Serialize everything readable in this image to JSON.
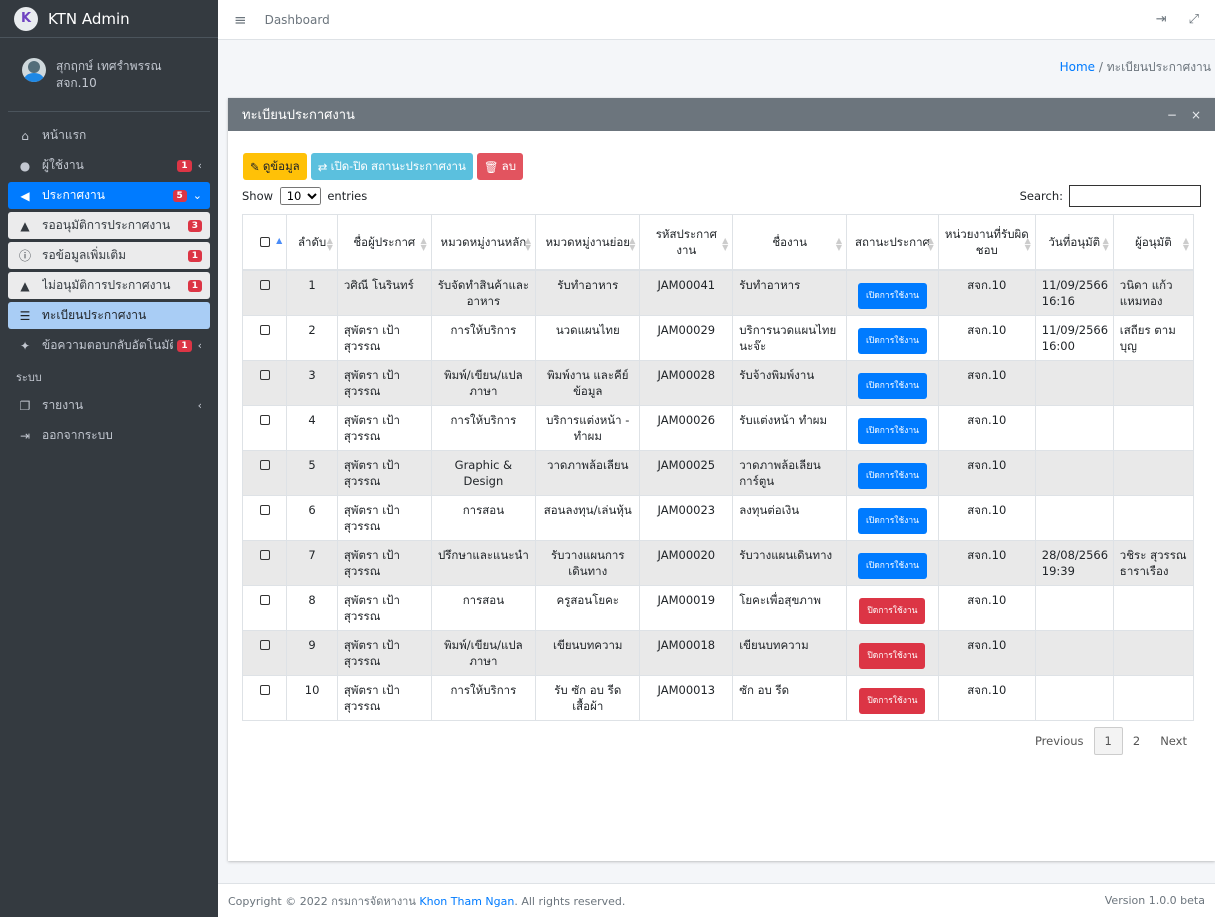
{
  "brand": {
    "name": "KTN Admin"
  },
  "user": {
    "name_line1": "สุกฤกษ์ เทศรำพรรณ",
    "name_line2": "สจก.10"
  },
  "nav": {
    "home": "หน้าแรก",
    "users": {
      "label": "ผู้ใช้งาน",
      "badge": "1"
    },
    "jobs": {
      "label": "ประกาศงาน",
      "badge": "5"
    },
    "pending": {
      "label": "รออนุมัติการประกาศงาน",
      "badge": "3"
    },
    "more_info": {
      "label": "รอข้อมูลเพิ่มเติม",
      "badge": "1"
    },
    "rejected": {
      "label": "ไม่อนุมัติการประกาศงาน",
      "badge": "1"
    },
    "registry": {
      "label": "ทะเบียนประกาศงาน"
    },
    "auto_reply": {
      "label": "ข้อความตอบกลับอัตโนมัติ",
      "badge": "1"
    },
    "system_header": "ระบบ",
    "reports": "รายงาน",
    "logout": "ออกจากระบบ"
  },
  "topbar": {
    "title": "Dashboard"
  },
  "breadcrumb": {
    "home": "Home",
    "sep": "/",
    "current": "ทะเบียนประกาศงาน"
  },
  "card": {
    "title": "ทะเบียนประกาศงาน",
    "buttons": {
      "view": "ดูข้อมูล",
      "toggle": "เปิด-ปิด สถานะประกาศงาน",
      "delete": "ลบ"
    },
    "show": "Show",
    "length_value": "10",
    "entries": "entries",
    "search_label": "Search:",
    "columns": [
      "ลำดับ",
      "ชื่อผู้ประกาศ",
      "หมวดหมู่งานหลัก",
      "หมวดหมู่งานย่อย",
      "รหัสประกาศงาน",
      "ชื่องาน",
      "สถานะประกาศ",
      "หน่วยงานที่รับผิดชอบ",
      "วันที่อนุมัติ",
      "ผู้อนุมัติ"
    ],
    "rows": [
      {
        "no": "1",
        "poster": "วศิณี โนรินทร์",
        "main": "รับจัดทำสินค้าและอาหาร",
        "sub": "รับทำอาหาร",
        "code": "JAM00041",
        "job": "รับทำอาหาร",
        "status": "เปิดการใช้งาน",
        "status_color": "#007bff",
        "unit": "สจก.10",
        "date": "11/09/2566 16:16",
        "approver": "วนิดา แก้วแหมทอง"
      },
      {
        "no": "2",
        "poster": "สุพัตรา เป้าสุวรรณ",
        "main": "การให้บริการ",
        "sub": "นวดแผนไทย",
        "code": "JAM00029",
        "job": "บริการนวดแผนไทย นะจ๊ะ",
        "status": "เปิดการใช้งาน",
        "status_color": "#007bff",
        "unit": "สจก.10",
        "date": "11/09/2566 16:00",
        "approver": "เสถียร ตามบุญ"
      },
      {
        "no": "3",
        "poster": "สุพัตรา เป้าสุวรรณ",
        "main": "พิมพ์/เขียน/แปลภาษา",
        "sub": "พิมพ์งาน และคีย์ข้อมูล",
        "code": "JAM00028",
        "job": "รับจ้างพิมพ์งาน",
        "status": "เปิดการใช้งาน",
        "status_color": "#007bff",
        "unit": "สจก.10",
        "date": "",
        "approver": ""
      },
      {
        "no": "4",
        "poster": "สุพัตรา เป้าสุวรรณ",
        "main": "การให้บริการ",
        "sub": "บริการแต่งหน้า - ทำผม",
        "code": "JAM00026",
        "job": "รับแต่งหน้า ทำผม",
        "status": "เปิดการใช้งาน",
        "status_color": "#007bff",
        "unit": "สจก.10",
        "date": "",
        "approver": ""
      },
      {
        "no": "5",
        "poster": "สุพัตรา เป้าสุวรรณ",
        "main": "Graphic & Design",
        "sub": "วาดภาพล้อเลียน",
        "code": "JAM00025",
        "job": "วาดภาพล้อเลียนการ์ตูน",
        "status": "เปิดการใช้งาน",
        "status_color": "#007bff",
        "unit": "สจก.10",
        "date": "",
        "approver": ""
      },
      {
        "no": "6",
        "poster": "สุพัตรา เป้าสุวรรณ",
        "main": "การสอน",
        "sub": "สอนลงทุน/เล่นหุ้น",
        "code": "JAM00023",
        "job": "ลงทุนต่อเงิน",
        "status": "เปิดการใช้งาน",
        "status_color": "#007bff",
        "unit": "สจก.10",
        "date": "",
        "approver": ""
      },
      {
        "no": "7",
        "poster": "สุพัตรา เป้าสุวรรณ",
        "main": "ปรึกษาและแนะนำ",
        "sub": "รับวางแผนการเดินทาง",
        "code": "JAM00020",
        "job": "รับวางแผนเดินทาง",
        "status": "เปิดการใช้งาน",
        "status_color": "#007bff",
        "unit": "สจก.10",
        "date": "28/08/2566 19:39",
        "approver": "วชิระ สุวรรณธาราเรือง"
      },
      {
        "no": "8",
        "poster": "สุพัตรา เป้าสุวรรณ",
        "main": "การสอน",
        "sub": "ครูสอนโยคะ",
        "code": "JAM00019",
        "job": "โยคะเพื่อสุขภาพ",
        "status": "ปิดการใช้งาน",
        "status_color": "#dc3545",
        "unit": "สจก.10",
        "date": "",
        "approver": ""
      },
      {
        "no": "9",
        "poster": "สุพัตรา เป้าสุวรรณ",
        "main": "พิมพ์/เขียน/แปลภาษา",
        "sub": "เขียนบทความ",
        "code": "JAM00018",
        "job": "เขียนบทความ",
        "status": "ปิดการใช้งาน",
        "status_color": "#dc3545",
        "unit": "สจก.10",
        "date": "",
        "approver": ""
      },
      {
        "no": "10",
        "poster": "สุพัตรา เป้าสุวรรณ",
        "main": "การให้บริการ",
        "sub": "รับ ซัก อบ รีด เสื้อผ้า",
        "code": "JAM00013",
        "job": "ซัก อบ รีด",
        "status": "ปิดการใช้งาน",
        "status_color": "#dc3545",
        "unit": "สจก.10",
        "date": "",
        "approver": ""
      }
    ],
    "pager": {
      "prev": "Previous",
      "p1": "1",
      "p2": "2",
      "next": "Next"
    }
  },
  "footer": {
    "copyright_pre": "Copyright © 2022 กรมการจัดหางาน",
    "org": "Khon Tham Ngan",
    "copyright_post": ". All rights reserved.",
    "version": "Version 1.0.0 beta"
  }
}
